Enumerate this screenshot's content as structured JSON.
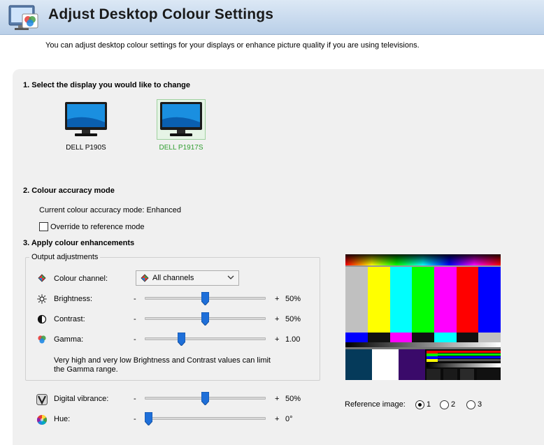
{
  "header": {
    "title": "Adjust Desktop Colour Settings",
    "subtitle": "You can adjust desktop colour settings for your displays or enhance picture quality if you are using televisions."
  },
  "section1": {
    "title": "1. Select the display you would like to change",
    "displays": [
      {
        "label": "DELL P190S",
        "selected": false
      },
      {
        "label": "DELL P1917S",
        "selected": true
      }
    ]
  },
  "section2": {
    "title": "2. Colour accuracy mode",
    "current_mode": "Current colour accuracy mode: Enhanced",
    "override_label": "Override to reference mode",
    "override_checked": false
  },
  "section3": {
    "title": "3. Apply colour enhancements",
    "group_title": "Output adjustments",
    "colour_channel_label": "Colour channel:",
    "colour_channel_value": "All channels",
    "sliders": [
      {
        "label": "Brightness:",
        "minus": "-",
        "plus": "+",
        "value": "50%",
        "level": 0.5,
        "icon": "sun-icon"
      },
      {
        "label": "Contrast:",
        "minus": "-",
        "plus": "+",
        "value": "50%",
        "level": 0.5,
        "icon": "contrast-icon"
      },
      {
        "label": "Gamma:",
        "minus": "-",
        "plus": "+",
        "value": "1.00",
        "level": 0.29,
        "icon": "gamma-icon"
      }
    ],
    "note": "Very high and very low Brightness and Contrast values can limit the Gamma range.",
    "extra_sliders": [
      {
        "label": "Digital vibrance:",
        "minus": "-",
        "plus": "+",
        "value": "50%",
        "level": 0.5,
        "icon": "vibrance-icon"
      },
      {
        "label": "Hue:",
        "minus": "-",
        "plus": "+",
        "value": "0°",
        "level": 0.0,
        "icon": "hue-icon"
      }
    ]
  },
  "reference": {
    "label": "Reference image:",
    "options": [
      "1",
      "2",
      "3"
    ],
    "selected": 0
  },
  "colors": {
    "selected_display_text": "#2f9e2f",
    "header_gradient_top": "#dce8f5",
    "header_gradient_bottom": "#b9cfe8"
  }
}
